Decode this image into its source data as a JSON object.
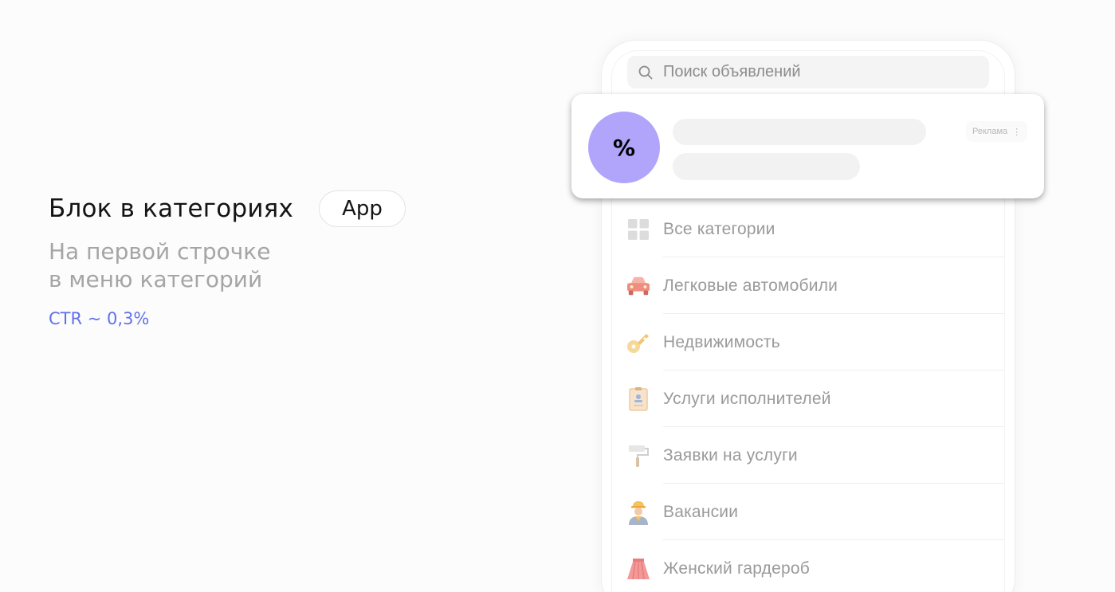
{
  "left": {
    "title": "Блок в категориях",
    "badge": "App",
    "subtitle": "На первой строчке\nв меню категорий",
    "ctr": "CTR ~ 0,3%"
  },
  "search": {
    "placeholder": "Поиск объявлений",
    "icon": "search-icon"
  },
  "ad": {
    "symbol": "%",
    "label": "Реклама",
    "menu": "⋮",
    "circle_color": "#b1a4fb"
  },
  "categories": [
    {
      "label": "Все категории",
      "icon": "grid-icon"
    },
    {
      "label": "Легковые автомобили",
      "icon": "car-icon"
    },
    {
      "label": "Недвижимость",
      "icon": "key-icon"
    },
    {
      "label": "Услуги исполнителей",
      "icon": "id-card-icon"
    },
    {
      "label": "Заявки на услуги",
      "icon": "paint-roller-icon"
    },
    {
      "label": "Вакансии",
      "icon": "worker-icon"
    },
    {
      "label": "Женский гардероб",
      "icon": "skirt-icon"
    }
  ],
  "colors": {
    "accent": "#6172e8",
    "muted_text": "#a5a5a5"
  }
}
